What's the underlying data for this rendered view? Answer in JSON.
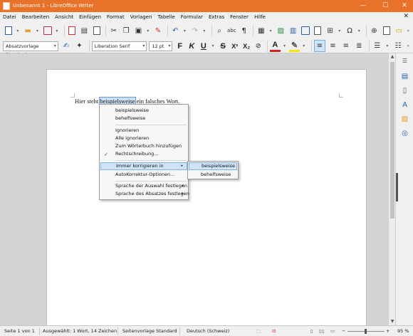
{
  "window": {
    "title": "Unbenannt 1 - LibreOffice Writer",
    "minimize": "—",
    "maximize": "☐",
    "close": "✕"
  },
  "menubar": {
    "items": [
      "Datei",
      "Bearbeiten",
      "Ansicht",
      "Einfügen",
      "Format",
      "Vorlagen",
      "Tabelle",
      "Formular",
      "Extras",
      "Fenster",
      "Hilfe"
    ],
    "close_doc": "✕"
  },
  "formatting": {
    "paragraph_style": "Absatzvorlage Standard",
    "font_name": "Liberation Serif",
    "font_size": "12 pt",
    "bold": "F",
    "italic": "K",
    "underline": "U",
    "strikethrough": "S",
    "superscript": "X²",
    "subscript": "X₂",
    "text_color": "A",
    "accent_color": "#e8722a",
    "font_color": "#d42020",
    "highlight_color": "#f5e600"
  },
  "document": {
    "text_before": "Hier steht ",
    "misspelled_word": "beispielsweise",
    "text_after": " ein falsches Wort."
  },
  "context_menu": {
    "suggestions": [
      "beispielsweise",
      "behelfsweise"
    ],
    "ignore": "Ignorieren",
    "ignore_all": "Alle ignorieren",
    "add_to_dictionary": "Zum Wörterbuch hinzufügen",
    "spelling": "Rechtschreibung...",
    "always_correct": "Immer korrigieren in",
    "autocorrect_options": "AutoKorrektur-Optionen...",
    "set_language_selection": "Sprache der Auswahl festlegen",
    "set_language_paragraph": "Sprache des Absatzes festlegen"
  },
  "submenu": {
    "items": [
      "beispielsweise",
      "behelfsweise"
    ]
  },
  "statusbar": {
    "page": "Seite 1 von 1",
    "selection": "Ausgewählt: 1 Wort, 14 Zeichen",
    "page_style": "Seitenvorlage Standard",
    "language": "Deutsch (Schweiz)",
    "zoom": "95 %"
  }
}
